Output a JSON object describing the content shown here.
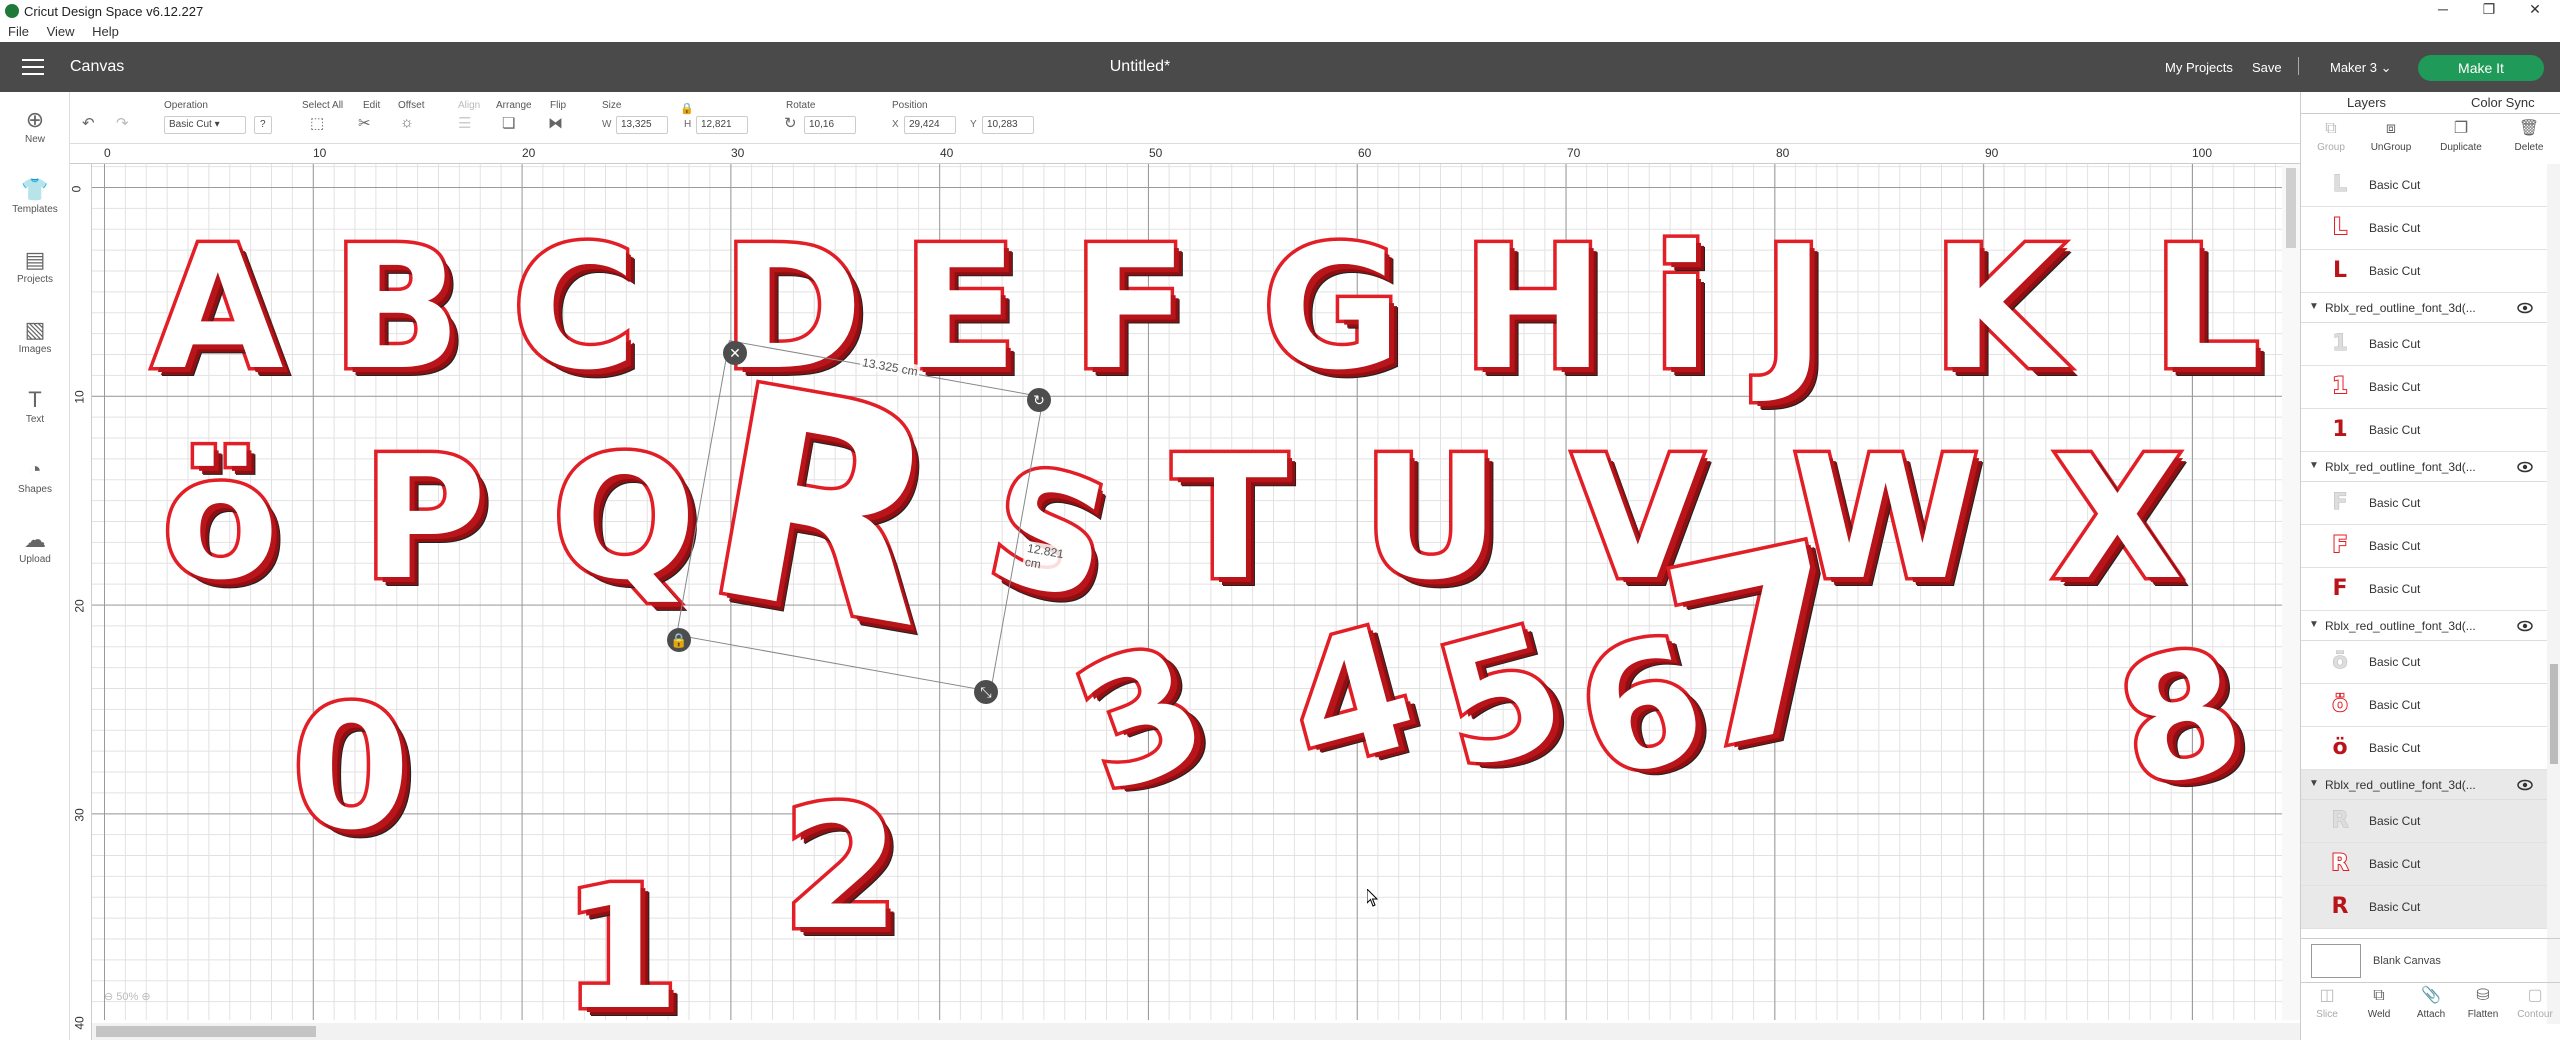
{
  "window": {
    "title": "Cricut Design Space  v6.12.227",
    "controls": [
      "─",
      "❐",
      "✕"
    ]
  },
  "menu": [
    "File",
    "View",
    "Help"
  ],
  "header": {
    "section": "Canvas",
    "doc_title": "Untitled*",
    "my_projects": "My Projects",
    "save": "Save",
    "machine": "Maker 3",
    "make_it": "Make It"
  },
  "left_nav": [
    "New",
    "Templates",
    "Projects",
    "Images",
    "Text",
    "Shapes",
    "Upload"
  ],
  "toolbar": {
    "operation_label": "Operation",
    "operation_value": "Basic Cut",
    "select_all": "Select All",
    "edit": "Edit",
    "offset": "Offset",
    "align": "Align",
    "arrange": "Arrange",
    "flip": "Flip",
    "size": "Size",
    "w_label": "W",
    "w_value": "13,325",
    "h_label": "H",
    "h_value": "12,821",
    "rotate": "Rotate",
    "rotate_value": "10,16",
    "position": "Position",
    "x_label": "X",
    "x_value": "29,424",
    "y_label": "Y",
    "y_value": "10,283"
  },
  "ruler_top": [
    "0",
    "10",
    "20",
    "30",
    "40",
    "50",
    "60",
    "70",
    "80",
    "90",
    "100"
  ],
  "ruler_left": [
    "0",
    "10",
    "20",
    "30",
    "40"
  ],
  "zoom": "50%",
  "selection": {
    "width_label": "13.325 cm",
    "height_label": "12.821 cm"
  },
  "glyphs": {
    "row1": [
      "A",
      "B",
      "C",
      "D",
      "E",
      "F",
      "G",
      "H",
      "i",
      "J",
      "K",
      "L"
    ],
    "row2": [
      "ö",
      "P",
      "Q",
      "S",
      "T",
      "U",
      "V",
      "W",
      "X"
    ],
    "selected": "R",
    "numbers": [
      "0",
      "1",
      "2",
      "3",
      "4",
      "5",
      "6",
      "7",
      "8"
    ]
  },
  "panel": {
    "tabs": [
      "Layers",
      "Color Sync"
    ],
    "tools": [
      "Group",
      "UnGroup",
      "Duplicate",
      "Delete"
    ],
    "layer_label": "Basic Cut",
    "groups": [
      "Rblx_red_outline_font_3d(...",
      "Rblx_red_outline_font_3d(...",
      "Rblx_red_outline_font_3d(...",
      "Rblx_red_outline_font_3d(..."
    ],
    "blank_canvas": "Blank Canvas",
    "bottom_tools": [
      "Slice",
      "Weld",
      "Attach",
      "Flatten",
      "Contour"
    ]
  },
  "colors": {
    "header_bg": "#4a4a4a",
    "make_it": "#1f9a58",
    "glyph_red": "#e21e26"
  }
}
